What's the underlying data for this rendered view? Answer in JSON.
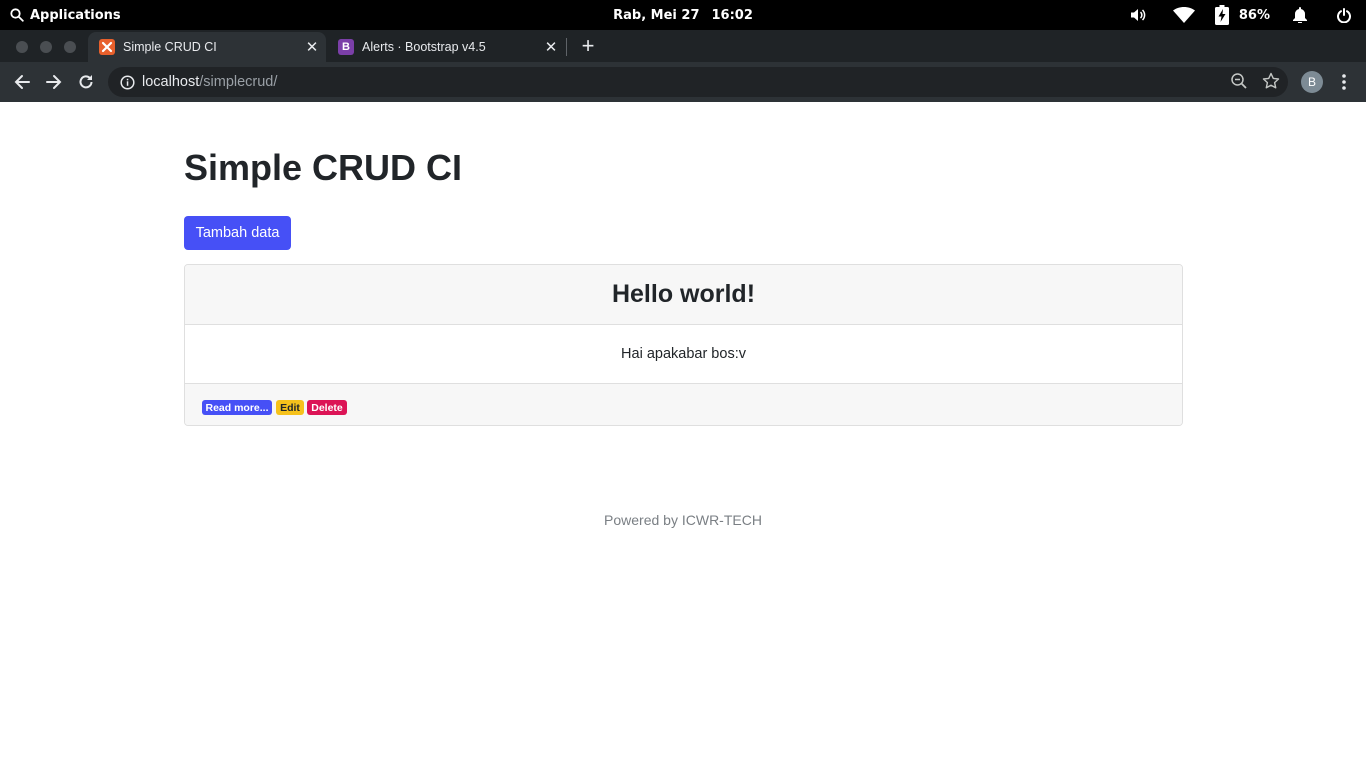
{
  "topbar": {
    "applications": "Applications",
    "date": "Rab, Mei 27",
    "time": "16:02",
    "battery_percent": "86%"
  },
  "tabs": [
    {
      "title": "Simple CRUD CI",
      "favicon_color": "#e8602c",
      "active": true
    },
    {
      "title": "Alerts · Bootstrap v4.5",
      "favicon_color": "#7b3fa8",
      "favicon_letter": "B",
      "active": false
    }
  ],
  "omnibox": {
    "host": "localhost",
    "path": "/simplecrud/"
  },
  "profile_initial": "B",
  "page": {
    "title": "Simple CRUD CI",
    "add_button": "Tambah data",
    "card": {
      "header": "Hello world!",
      "body": "Hai apakabar bos:v",
      "actions": {
        "read_more": "Read more...",
        "edit": "Edit",
        "delete": "Delete"
      }
    },
    "footer": "Powered by ICWR-TECH"
  },
  "colors": {
    "primary": "#4650f6",
    "warning": "#f6c21c",
    "danger": "#dc1456"
  }
}
